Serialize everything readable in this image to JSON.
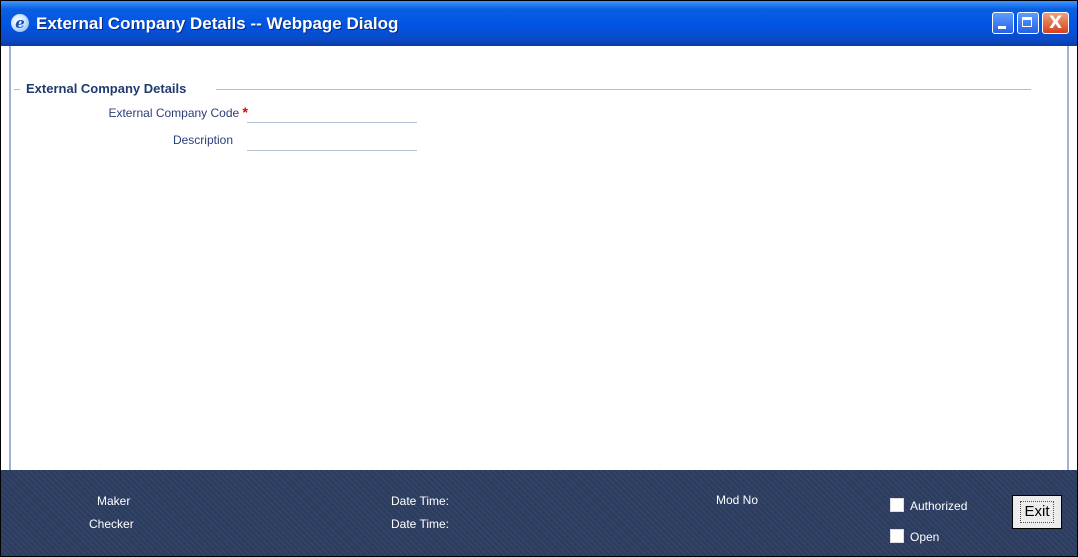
{
  "window": {
    "title": "External Company Details -- Webpage Dialog",
    "icon": "ie-icon",
    "controls": {
      "minimize_icon": "minimize-icon",
      "maximize_icon": "maximize-icon",
      "close_icon": "close-icon",
      "close_glyph": "X"
    }
  },
  "form": {
    "section_legend": "External Company Details",
    "fields": [
      {
        "label": "External Company Code",
        "required_marker": "*",
        "value": "",
        "placeholder": ""
      },
      {
        "label": "Description",
        "value": "",
        "placeholder": ""
      }
    ]
  },
  "footer": {
    "maker_label": "Maker",
    "checker_label": "Checker",
    "maker_datetime_label": "Date Time:",
    "checker_datetime_label": "Date Time:",
    "mod_no_label": "Mod No",
    "authorized_label": "Authorized",
    "authorized_checked": false,
    "open_label": "Open",
    "open_checked": false,
    "exit_label": "Exit"
  },
  "colors": {
    "titlebar": "#0054e3",
    "footer": "#2c3d60",
    "label_text": "#2a3f7a",
    "required": "#e00000"
  }
}
